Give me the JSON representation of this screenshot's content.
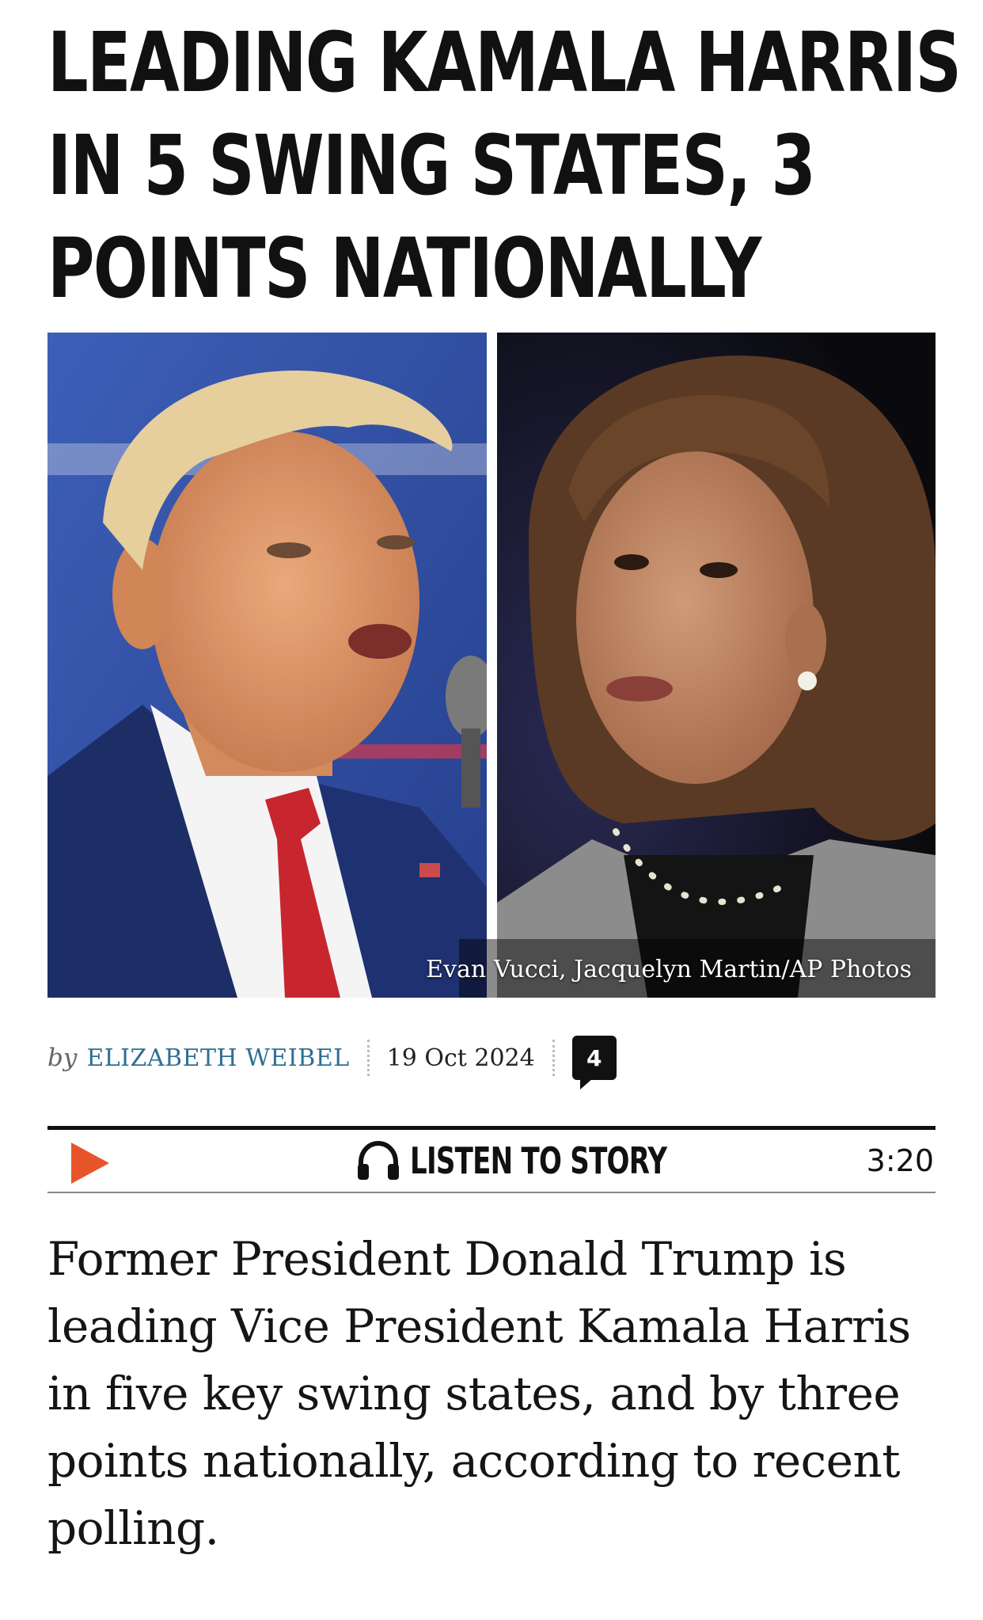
{
  "article": {
    "headline_lines": [
      "LEADING KAMALA HARRIS",
      "IN 5 SWING STATES, 3",
      "POINTS NATIONALLY"
    ],
    "photo": {
      "credit": "Evan Vucci, Jacquelyn Martin/AP Photos"
    },
    "byline": {
      "prefix": "by",
      "author": "ELIZABETH WEIBEL",
      "date": "19 Oct 2024",
      "comment_count": "4"
    },
    "audio": {
      "label": "LISTEN TO STORY",
      "duration": "3:20",
      "play_color": "#e8542a"
    },
    "lede": "Former President Donald Trump is leading Vice President Kamala Harris in five key swing states, and by three points nationally, according to recent polling."
  },
  "icons": {
    "play": "play-icon",
    "headphones": "headphones-icon",
    "comment": "comment-bubble-icon"
  },
  "colors": {
    "author_link": "#2e6f95",
    "accent": "#e8542a",
    "text": "#111111"
  }
}
